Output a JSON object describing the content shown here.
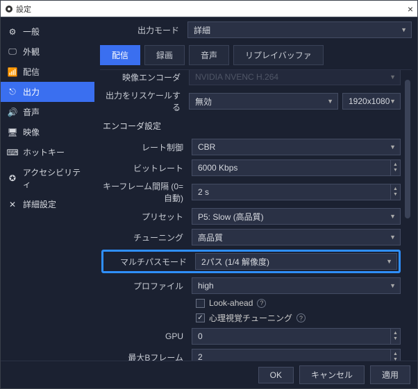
{
  "titlebar": {
    "title": "設定"
  },
  "sidebar": {
    "items": [
      {
        "label": "一般"
      },
      {
        "label": "外観"
      },
      {
        "label": "配信"
      },
      {
        "label": "出力"
      },
      {
        "label": "音声"
      },
      {
        "label": "映像"
      },
      {
        "label": "ホットキー"
      },
      {
        "label": "アクセシビリティ"
      },
      {
        "label": "詳細設定"
      }
    ]
  },
  "output_mode": {
    "label": "出力モード",
    "value": "詳細"
  },
  "tabs": {
    "stream": "配信",
    "record": "録画",
    "audio": "音声",
    "replay": "リプレイバッファ"
  },
  "top": {
    "encoder_label": "映像エンコーダ",
    "encoder_value": "NVIDIA NVENC H.264",
    "rescale_label": "出力をリスケールする",
    "rescale_value": "無効",
    "rescale_res": "1920x1080"
  },
  "enc_title": "エンコーダ設定",
  "enc": {
    "rate_control": {
      "label": "レート制御",
      "value": "CBR"
    },
    "bitrate": {
      "label": "ビットレート",
      "value": "6000 Kbps"
    },
    "keyframe": {
      "label": "キーフレーム間隔 (0=自動)",
      "value": "2 s"
    },
    "preset": {
      "label": "プリセット",
      "value": "P5: Slow (高品質)"
    },
    "tuning": {
      "label": "チューニング",
      "value": "高品質"
    },
    "multipass": {
      "label": "マルチパスモード",
      "value": "2パス (1/4 解像度)"
    },
    "profile": {
      "label": "プロファイル",
      "value": "high"
    },
    "lookahead": {
      "label": "Look-ahead"
    },
    "psycho": {
      "label": "心理視覚チューニング"
    },
    "gpu": {
      "label": "GPU",
      "value": "0"
    },
    "bframes": {
      "label": "最大Bフレーム",
      "value": "2"
    }
  },
  "footer": {
    "ok": "OK",
    "cancel": "キャンセル",
    "apply": "適用"
  }
}
